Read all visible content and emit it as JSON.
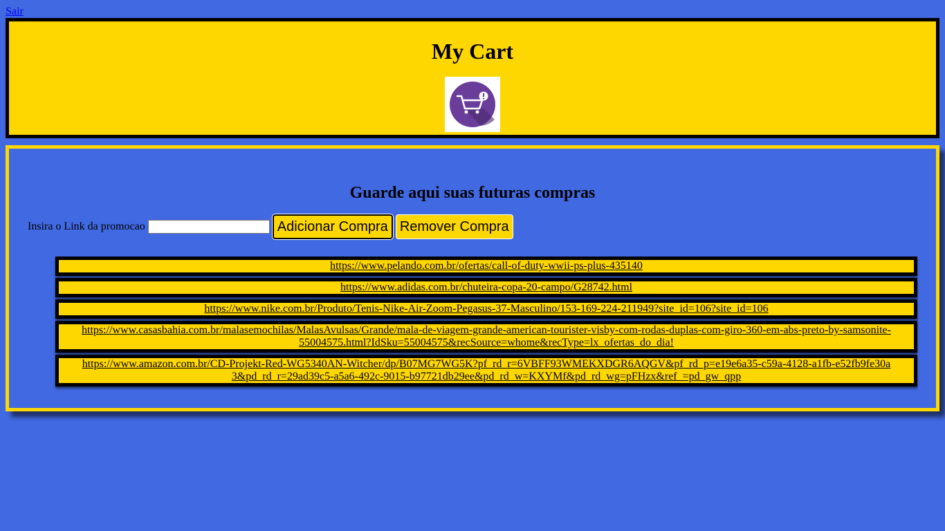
{
  "nav": {
    "logout_label": "Sair"
  },
  "header": {
    "title": "My Cart",
    "logo_icon": "shopping-cart-alert-icon"
  },
  "main": {
    "heading": "Guarde aqui suas futuras compras",
    "form": {
      "label": "Insira o Link da promocao",
      "input_value": "",
      "add_label": "Adicionar Compra",
      "remove_label": "Remover Compra"
    },
    "links": [
      "https://www.pelando.com.br/ofertas/call-of-duty-wwii-ps-plus-435140",
      "https://www.adidas.com.br/chuteira-copa-20-campo/G28742.html",
      "https://www.nike.com.br/Produto/Tenis-Nike-Air-Zoom-Pegasus-37-Masculino/153-169-224-211949?site_id=106?site_id=106",
      "https://www.casasbahia.com.br/malasemochilas/MalasAvulsas/Grande/mala-de-viagem-grande-american-tourister-visby-com-rodas-duplas-com-giro-360-em-abs-preto-by-samsonite-55004575.html?IdSku=55004575&recSource=whome&recType=lx_ofertas_do_dia!",
      "https://www.amazon.com.br/CD-Projekt-Red-WG5340AN-Witcher/dp/B07MG7WG5K?pf_rd_r=6VBFF93WMEKXDGR6AQGV&pf_rd_p=e19e6a35-c59a-4128-a1fb-e52fb9fe30a3&pd_rd_r=29ad39c5-a5a6-492c-9015-b97721db29ee&pd_rd_w=KXYMf&pd_rd_wg=pFHzx&ref_=pd_gw_qpp"
    ]
  },
  "colors": {
    "background": "#4169e1",
    "accent": "#ffd700",
    "logo": "#6a3d9a"
  }
}
